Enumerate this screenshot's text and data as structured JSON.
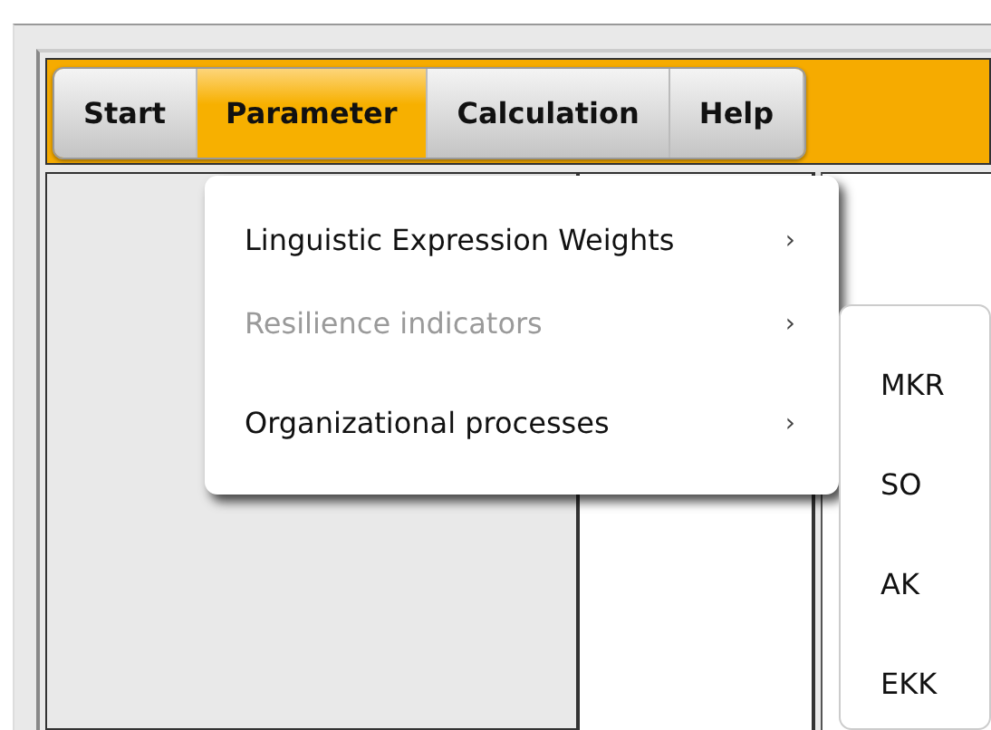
{
  "menubar": [
    {
      "label": "Start",
      "selected": false
    },
    {
      "label": "Parameter",
      "selected": true
    },
    {
      "label": "Calculation",
      "selected": false
    },
    {
      "label": "Help",
      "selected": false
    }
  ],
  "dropdown": {
    "items": [
      {
        "label": "Linguistic Expression Weights",
        "disabled": false,
        "submenu": "›"
      },
      {
        "label": "Resilience indicators",
        "disabled": true,
        "submenu": "›"
      },
      {
        "label": "Organizational processes",
        "disabled": false,
        "submenu": "›"
      }
    ]
  },
  "submenu": {
    "items": [
      {
        "label": "MKR"
      },
      {
        "label": "SO"
      },
      {
        "label": "AK"
      },
      {
        "label": "EKK"
      }
    ]
  }
}
